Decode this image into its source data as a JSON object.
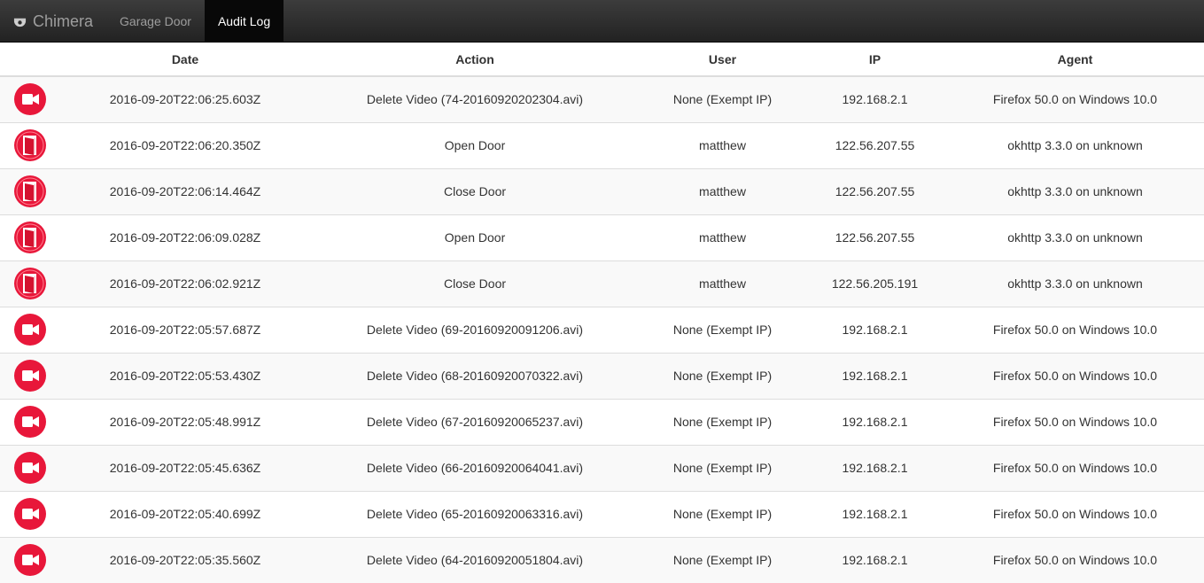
{
  "navbar": {
    "brand": "Chimera",
    "brand_icon": "dome-camera-icon",
    "links": [
      {
        "label": "Garage Door",
        "active": false
      },
      {
        "label": "Audit Log",
        "active": true
      }
    ]
  },
  "colors": {
    "navbar_bg": "#222222",
    "active_link_bg": "#080808",
    "icon_red": "#e8173a",
    "stripe": "#f9f9f9"
  },
  "table": {
    "headers": [
      "Date",
      "Action",
      "User",
      "IP",
      "Agent"
    ],
    "rows": [
      {
        "icon": "video-camera-icon",
        "date": "2016-09-20T22:06:25.603Z",
        "action": "Delete Video (74-20160920202304.avi)",
        "user": "None (Exempt IP)",
        "ip": "192.168.2.1",
        "agent": "Firefox 50.0 on Windows 10.0"
      },
      {
        "icon": "door-icon",
        "date": "2016-09-20T22:06:20.350Z",
        "action": "Open Door",
        "user": "matthew",
        "ip": "122.56.207.55",
        "agent": "okhttp 3.3.0 on unknown"
      },
      {
        "icon": "door-icon",
        "date": "2016-09-20T22:06:14.464Z",
        "action": "Close Door",
        "user": "matthew",
        "ip": "122.56.207.55",
        "agent": "okhttp 3.3.0 on unknown"
      },
      {
        "icon": "door-icon",
        "date": "2016-09-20T22:06:09.028Z",
        "action": "Open Door",
        "user": "matthew",
        "ip": "122.56.207.55",
        "agent": "okhttp 3.3.0 on unknown"
      },
      {
        "icon": "door-icon",
        "date": "2016-09-20T22:06:02.921Z",
        "action": "Close Door",
        "user": "matthew",
        "ip": "122.56.205.191",
        "agent": "okhttp 3.3.0 on unknown"
      },
      {
        "icon": "video-camera-icon",
        "date": "2016-09-20T22:05:57.687Z",
        "action": "Delete Video (69-20160920091206.avi)",
        "user": "None (Exempt IP)",
        "ip": "192.168.2.1",
        "agent": "Firefox 50.0 on Windows 10.0"
      },
      {
        "icon": "video-camera-icon",
        "date": "2016-09-20T22:05:53.430Z",
        "action": "Delete Video (68-20160920070322.avi)",
        "user": "None (Exempt IP)",
        "ip": "192.168.2.1",
        "agent": "Firefox 50.0 on Windows 10.0"
      },
      {
        "icon": "video-camera-icon",
        "date": "2016-09-20T22:05:48.991Z",
        "action": "Delete Video (67-20160920065237.avi)",
        "user": "None (Exempt IP)",
        "ip": "192.168.2.1",
        "agent": "Firefox 50.0 on Windows 10.0"
      },
      {
        "icon": "video-camera-icon",
        "date": "2016-09-20T22:05:45.636Z",
        "action": "Delete Video (66-20160920064041.avi)",
        "user": "None (Exempt IP)",
        "ip": "192.168.2.1",
        "agent": "Firefox 50.0 on Windows 10.0"
      },
      {
        "icon": "video-camera-icon",
        "date": "2016-09-20T22:05:40.699Z",
        "action": "Delete Video (65-20160920063316.avi)",
        "user": "None (Exempt IP)",
        "ip": "192.168.2.1",
        "agent": "Firefox 50.0 on Windows 10.0"
      },
      {
        "icon": "video-camera-icon",
        "date": "2016-09-20T22:05:35.560Z",
        "action": "Delete Video (64-20160920051804.avi)",
        "user": "None (Exempt IP)",
        "ip": "192.168.2.1",
        "agent": "Firefox 50.0 on Windows 10.0"
      }
    ]
  }
}
